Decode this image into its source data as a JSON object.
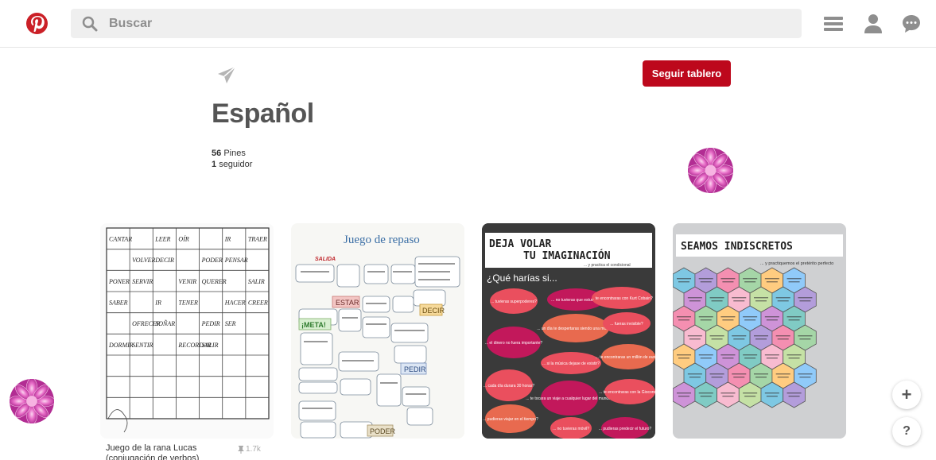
{
  "header": {
    "search_placeholder": "Buscar"
  },
  "board": {
    "follow_label": "Seguir tablero",
    "title": "Español",
    "pins_count": "56",
    "pins_label": "Pines",
    "followers_count": "1",
    "followers_label": "seguidor"
  },
  "pins": [
    {
      "description": "Juego de la rana Lucas (conjugación de verbos)",
      "saves": "1.7k",
      "grid_words": [
        "CANTAR",
        "LEER",
        "OÍR",
        "IR",
        "TRAER",
        "VOLVER",
        "DECIR",
        "PODER",
        "PENSAR",
        "PONER",
        "SERVIR",
        "VENIR",
        "QUERER",
        "SALIR",
        "SABER",
        "IR",
        "TENER",
        "HACER",
        "CREER",
        "OFRECER",
        "SOÑAR",
        "PEDIR",
        "SER",
        "DORMIR",
        "SENTIR",
        "RECORDAR",
        "SALIR"
      ]
    },
    {
      "title": "Juego de repaso",
      "words": [
        "SALIDA",
        "ESTAR",
        "DECIR",
        "¡META!",
        "PEDIR",
        "PODER"
      ]
    },
    {
      "title_line1": "DEJA VOLAR",
      "title_line2": "TU IMAGINACIÓN",
      "subtitle": "... y practica el condicional",
      "question": "¿Qué harías si...",
      "bubbles": [
        "... tuvieras superpoderes?",
        "... no tuvieras que estudiar?",
        "... te encontraras con Kurt Cobain?",
        "... un día te despertaras siendo una mosca?",
        "... fueras invisible?",
        "... el dinero no fuera importante?",
        "... si la música dejase de existir?",
        "... te encontraras un millón de euros?",
        "... cada día durara 30 horas?",
        "... te tocara un viaje a cualquier lugar del mundo?",
        "... te encontraras con la Gioconda?",
        "... pudieras viajar en el tiempo?",
        "... no tuvieras móvil?",
        "... pudieras predecir el futuro?"
      ]
    },
    {
      "title": "SEAMOS INDISCRETOS",
      "subtitle": "... y practiquemos el pretérito perfecto"
    }
  ],
  "colors": {
    "brand": "#bd081c",
    "search_bg": "#efefef",
    "icon_grey": "#8e8e8e"
  }
}
